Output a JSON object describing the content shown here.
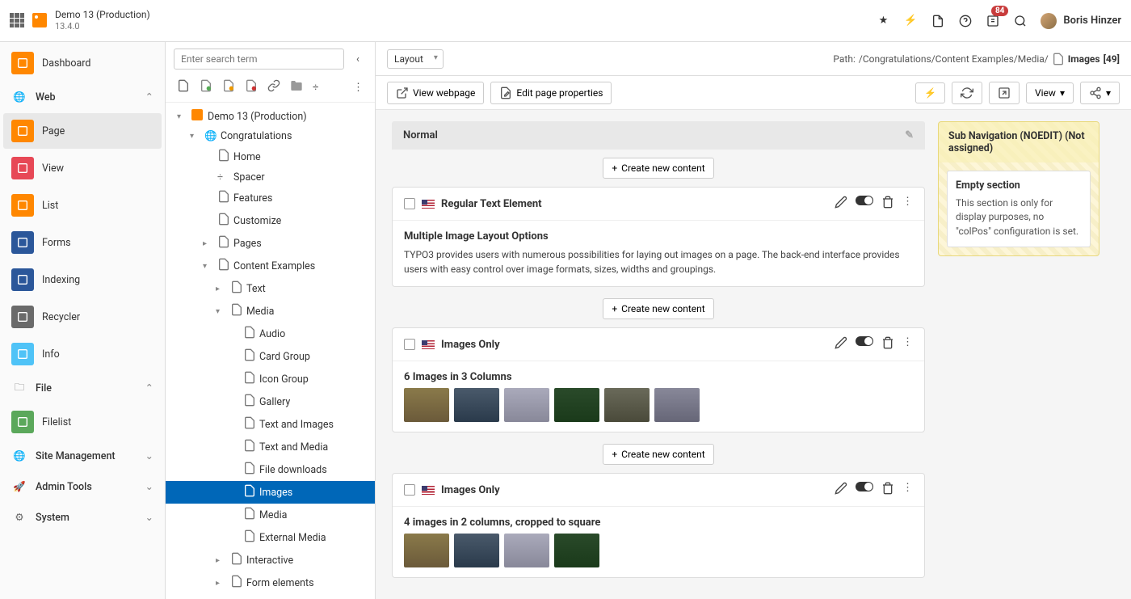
{
  "app": {
    "site_name": "Demo 13 (Production)",
    "version": "13.4.0",
    "badge_count": "84",
    "user_name": "Boris Hinzer"
  },
  "module_menu": {
    "items": [
      {
        "label": "Dashboard",
        "icon": "mi-dash"
      },
      {
        "label": "Web",
        "section": true,
        "expanded": true
      },
      {
        "label": "Page",
        "icon": "mi-page",
        "active": true
      },
      {
        "label": "View",
        "icon": "mi-view"
      },
      {
        "label": "List",
        "icon": "mi-list"
      },
      {
        "label": "Forms",
        "icon": "mi-forms"
      },
      {
        "label": "Indexing",
        "icon": "mi-index"
      },
      {
        "label": "Recycler",
        "icon": "mi-recycle"
      },
      {
        "label": "Info",
        "icon": "mi-info"
      },
      {
        "label": "File",
        "section": true,
        "expanded": true
      },
      {
        "label": "Filelist",
        "icon": "mi-file"
      },
      {
        "label": "Site Management",
        "section": true,
        "expanded": false
      },
      {
        "label": "Admin Tools",
        "section": true,
        "expanded": false
      },
      {
        "label": "System",
        "section": true,
        "expanded": false
      }
    ]
  },
  "tree": {
    "search_placeholder": "Enter search term",
    "nodes": [
      {
        "depth": 0,
        "label": "Demo 13 (Production)",
        "caret": "▾",
        "icon": "logo"
      },
      {
        "depth": 1,
        "label": "Congratulations",
        "caret": "▾",
        "icon": "globe"
      },
      {
        "depth": 2,
        "label": "Home",
        "caret": "",
        "icon": "page"
      },
      {
        "depth": 2,
        "label": "Spacer",
        "caret": "",
        "icon": "spacer"
      },
      {
        "depth": 2,
        "label": "Features",
        "caret": "",
        "icon": "page"
      },
      {
        "depth": 2,
        "label": "Customize",
        "caret": "",
        "icon": "page"
      },
      {
        "depth": 2,
        "label": "Pages",
        "caret": "▸",
        "icon": "page"
      },
      {
        "depth": 2,
        "label": "Content Examples",
        "caret": "▾",
        "icon": "page"
      },
      {
        "depth": 3,
        "label": "Text",
        "caret": "▸",
        "icon": "folder"
      },
      {
        "depth": 3,
        "label": "Media",
        "caret": "▾",
        "icon": "folder"
      },
      {
        "depth": 4,
        "label": "Audio",
        "caret": "",
        "icon": "file"
      },
      {
        "depth": 4,
        "label": "Card Group",
        "caret": "",
        "icon": "file"
      },
      {
        "depth": 4,
        "label": "Icon Group",
        "caret": "",
        "icon": "file"
      },
      {
        "depth": 4,
        "label": "Gallery",
        "caret": "",
        "icon": "file"
      },
      {
        "depth": 4,
        "label": "Text and Images",
        "caret": "",
        "icon": "file"
      },
      {
        "depth": 4,
        "label": "Text and Media",
        "caret": "",
        "icon": "file"
      },
      {
        "depth": 4,
        "label": "File downloads",
        "caret": "",
        "icon": "file"
      },
      {
        "depth": 4,
        "label": "Images",
        "caret": "",
        "icon": "file",
        "selected": true
      },
      {
        "depth": 4,
        "label": "Media",
        "caret": "",
        "icon": "file"
      },
      {
        "depth": 4,
        "label": "External Media",
        "caret": "",
        "icon": "file"
      },
      {
        "depth": 3,
        "label": "Interactive",
        "caret": "▸",
        "icon": "folder"
      },
      {
        "depth": 3,
        "label": "Form elements",
        "caret": "▸",
        "icon": "folder"
      }
    ]
  },
  "content_toolbar": {
    "layout_select": "Layout",
    "path_label": "Path: ",
    "path_value": "/Congratulations/Content Examples/Media/",
    "page_name": "Images",
    "page_id": "[49]",
    "view_webpage": "View webpage",
    "edit_props": "Edit page properties",
    "view_btn": "View"
  },
  "columns": {
    "normal": {
      "title": "Normal",
      "create_label": "Create new content",
      "elements": [
        {
          "title": "Regular Text Element",
          "heading": "Multiple Image Layout Options",
          "body": "TYPO3 provides users with numerous possibilities for laying out images on a page. The back-end interface provides users with easy control over image formats, sizes, widths and groupings.",
          "thumbs": 0
        },
        {
          "title": "Images Only",
          "heading": "6 Images in 3 Columns",
          "body": "",
          "thumbs": 6
        },
        {
          "title": "Images Only",
          "heading": "4 images in 2 columns, cropped to square",
          "body": "",
          "thumbs": 4
        }
      ]
    },
    "side": {
      "title": "Sub Navigation (NOEDIT) (Not assigned)",
      "empty_heading": "Empty section",
      "empty_body": "This section is only for display purposes, no \"colPos\" configuration is set."
    }
  }
}
